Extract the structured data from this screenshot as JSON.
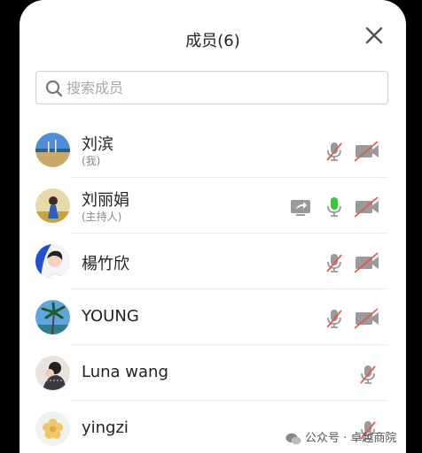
{
  "header": {
    "title": "成员(6)",
    "close_icon": "close-icon"
  },
  "search": {
    "placeholder": "搜索成员",
    "value": "",
    "icon": "search-icon"
  },
  "members": [
    {
      "name": "刘滨",
      "sub": "(我)",
      "icons": [
        "mic-muted-icon",
        "camera-off-icon"
      ]
    },
    {
      "name": "刘丽娟",
      "sub": "(主持人)",
      "icons": [
        "screen-share-icon",
        "mic-active-icon",
        "camera-off-icon"
      ]
    },
    {
      "name": "楊竹欣",
      "sub": "",
      "icons": [
        "mic-muted-icon",
        "camera-off-icon"
      ]
    },
    {
      "name": "YOUNG",
      "sub": "",
      "icons": [
        "mic-muted-icon",
        "camera-off-icon"
      ]
    },
    {
      "name": "Luna wang",
      "sub": "",
      "icons": [
        "mic-muted-icon"
      ]
    },
    {
      "name": "yingzi",
      "sub": "",
      "icons": [
        "mic-muted-icon"
      ]
    }
  ],
  "watermark": {
    "text": "公众号 · 卓越商院"
  },
  "colors": {
    "muted_red": "#e05a4e",
    "icon_gray": "#9a9a9a",
    "mic_active": "#39c734"
  }
}
